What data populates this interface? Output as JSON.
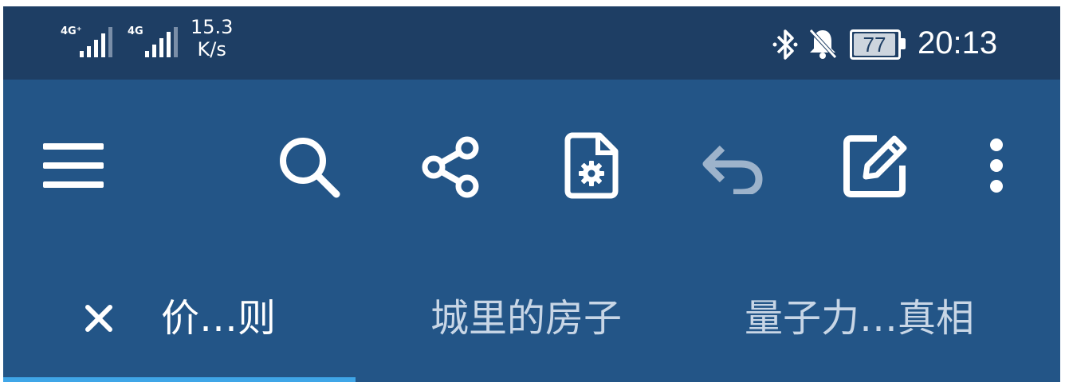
{
  "status_bar": {
    "network1_label": "4G⁺",
    "network2_label": "4G",
    "speed_value": "15.3",
    "speed_unit": "K/s",
    "battery_level": "77",
    "time": "20:13",
    "icons": [
      "signal-icon",
      "signal-icon",
      "bluetooth-icon",
      "notifications-off-icon",
      "battery-icon"
    ]
  },
  "toolbar": {
    "icons": [
      "menu-icon",
      "search-icon",
      "share-icon",
      "document-settings-icon",
      "undo-icon",
      "edit-icon",
      "more-vert-icon"
    ]
  },
  "tabs": [
    {
      "label": "价…则",
      "active": true,
      "closable": true
    },
    {
      "label": "城里的房子",
      "active": false
    },
    {
      "label": "量子力…真相",
      "active": false
    }
  ],
  "colors": {
    "status_bar": "#1e3e64",
    "app_bar": "#235587",
    "tab_indicator": "#3fa6e8",
    "icon": "#ffffff",
    "inactive_text": "#c8d6e6"
  }
}
